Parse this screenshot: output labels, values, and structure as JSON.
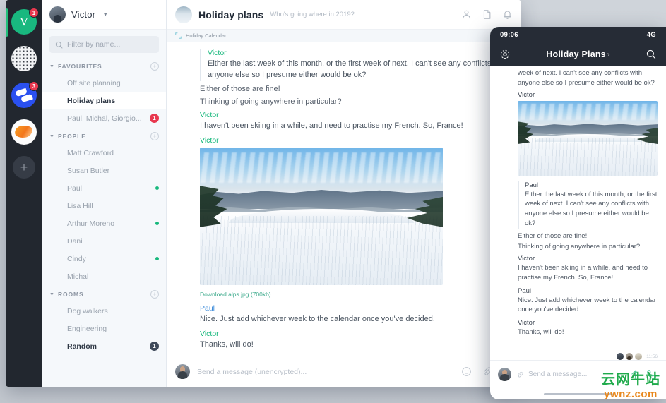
{
  "colors": {
    "accent_green": "#17b87c",
    "accent_blue": "#3b8ad9",
    "badge_red": "#e8384f",
    "rail_dark": "#22272f",
    "sidebar_bg": "#f5f8fb"
  },
  "rail": {
    "items": [
      {
        "name": "account-victor",
        "letter": "V",
        "badge": "1",
        "style": "av-v"
      },
      {
        "name": "space-dots",
        "letter": "",
        "badge": "",
        "style": "av-dots"
      },
      {
        "name": "space-blue",
        "letter": "",
        "badge": "3",
        "style": "av-blue"
      },
      {
        "name": "space-orange",
        "letter": "",
        "badge": "",
        "style": "av-orange"
      }
    ],
    "add_label": "+"
  },
  "sidebar": {
    "user": {
      "name": "Victor",
      "caret": "⌄"
    },
    "search": {
      "placeholder": "Filter by name...",
      "icon": "search-icon"
    },
    "sections": [
      {
        "title": "FAVOURITES",
        "items": [
          {
            "label": "Off site planning",
            "avatar": "office",
            "badge": "",
            "selected": false,
            "presence": false
          },
          {
            "label": "Holiday plans",
            "avatar": "slope",
            "badge": "",
            "selected": true,
            "presence": false
          },
          {
            "label": "Paul, Michal, Giorgio...",
            "avatar": "grouplight",
            "badge": "1",
            "badge_style": "badge-red",
            "selected": false,
            "presence": false
          }
        ]
      },
      {
        "title": "PEOPLE",
        "items": [
          {
            "label": "Matt Crawford",
            "avatar": "office",
            "badge": "",
            "selected": false,
            "presence": false
          },
          {
            "label": "Susan Butler",
            "avatar": "dark",
            "badge": "",
            "selected": false,
            "presence": false
          },
          {
            "label": "Paul",
            "avatar": "paul",
            "badge": "",
            "selected": false,
            "presence": true
          },
          {
            "label": "Lisa Hill",
            "avatar": "lady",
            "badge": "",
            "selected": false,
            "presence": false
          },
          {
            "label": "Arthur Moreno",
            "avatar": "cindy",
            "badge": "",
            "selected": false,
            "presence": true
          },
          {
            "label": "Dani",
            "avatar": "dark",
            "badge": "",
            "selected": false,
            "presence": false
          },
          {
            "label": "Cindy",
            "avatar": "cindy",
            "badge": "",
            "selected": false,
            "presence": true
          },
          {
            "label": "Michal",
            "avatar": "michal",
            "badge": "",
            "selected": false,
            "presence": false
          }
        ]
      },
      {
        "title": "ROOMS",
        "items": [
          {
            "label": "Dog walkers",
            "avatar": "dog",
            "badge": "",
            "selected": false,
            "presence": false
          },
          {
            "label": "Engineering",
            "avatar": "engi",
            "badge": "",
            "selected": false,
            "presence": false
          },
          {
            "label": "Random",
            "avatar": "mount",
            "badge": "1",
            "badge_style": "badge-dark",
            "selected": false,
            "bold": true,
            "presence": false
          }
        ]
      }
    ],
    "section_add_label": "+",
    "section_chevron": "⌄"
  },
  "chat": {
    "title": "Holiday plans",
    "subtitle": "Who's going where in 2019?",
    "pinned_label": "Holiday Calendar",
    "header_icons": [
      "people-icon",
      "file-icon",
      "bell-icon"
    ],
    "messages": [
      {
        "type": "quoted",
        "sender": "Victor",
        "sender_color": "green",
        "text": "Either the last week of this month, or the first week of next. I can't see any conflicts with anyone else so I presume either would be ok?"
      },
      {
        "type": "continuation",
        "text": "Either of those are fine!"
      },
      {
        "type": "continuation",
        "text": "Thinking of going anywhere in particular?"
      },
      {
        "type": "normal",
        "sender": "Victor",
        "sender_color": "green",
        "text": "I haven't been skiing in a while, and need to practise my French. So, France!"
      },
      {
        "type": "image",
        "sender": "Victor",
        "sender_color": "green",
        "download_label": "Download alps.jpg (700kb)"
      },
      {
        "type": "normal",
        "sender": "Paul",
        "sender_color": "blue",
        "text": "Nice. Just add whichever week to the calendar once you've decided."
      },
      {
        "type": "normal",
        "sender": "Victor",
        "sender_color": "green",
        "text": "Thanks, will do!"
      }
    ],
    "composer": {
      "placeholder": "Send a message (unencrypted)...",
      "icons": [
        "emoji-icon",
        "attachment-icon",
        "call-icon"
      ]
    }
  },
  "phone": {
    "status": {
      "time": "09:06",
      "network": "4G"
    },
    "header": {
      "title": "Holiday Plans",
      "chevron": "›",
      "left_icon": "gear-icon",
      "right_icon": "search-icon"
    },
    "messages": [
      {
        "type": "continuation",
        "text": "week of next. I can't see any conflicts with anyone else so I presume either would be ok?"
      },
      {
        "type": "image",
        "sender": "Victor"
      },
      {
        "type": "quoted",
        "sender": "Paul",
        "text": "Either the last week of this month, or the first week of next. I can't see any conflicts with anyone else so I presume either would be ok?"
      },
      {
        "type": "continuation",
        "text": "Either of those are fine!"
      },
      {
        "type": "continuation",
        "text": "Thinking of going anywhere in particular?"
      },
      {
        "type": "normal",
        "sender": "Victor",
        "text": "I haven't been skiing in a while, and need to practise my French. So, France!"
      },
      {
        "type": "normal",
        "sender": "Paul",
        "text": "Nice. Just add whichever week to the calendar once you've decided."
      },
      {
        "type": "normal",
        "sender": "Victor",
        "text": "Thanks, will do!"
      }
    ],
    "read_receipt_time": "11:56",
    "composer": {
      "placeholder": "Send a message...",
      "icons": [
        "send-icon",
        "call-icon"
      ]
    }
  },
  "watermark": {
    "line1": "云网牛站",
    "line2": "ywnz.com"
  }
}
